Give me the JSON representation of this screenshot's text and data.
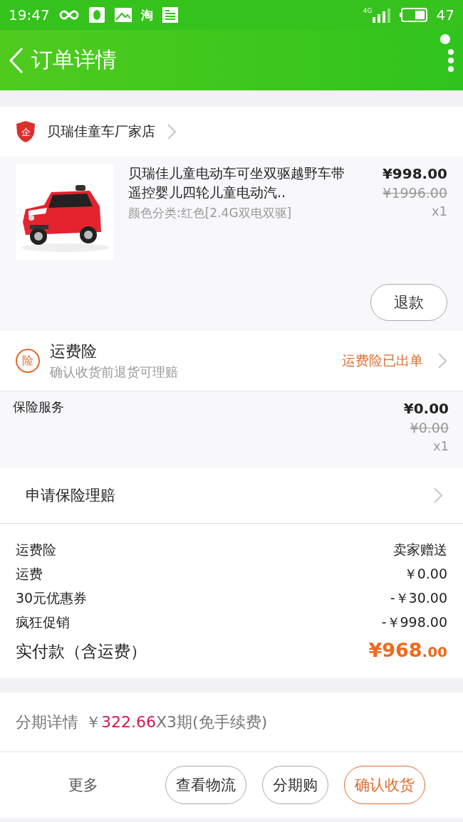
{
  "status_bar": {
    "time": "19:47",
    "app_glyph": "淘",
    "network": "4G",
    "battery": "47"
  },
  "header": {
    "title": "订单详情"
  },
  "shop": {
    "name": "贝瑞佳童车厂家店",
    "badge": "企"
  },
  "product": {
    "kind": "picture",
    "title": "贝瑞佳儿童电动车可坐双驱越野车带遥控婴儿四轮儿童电动汽..",
    "spec": "颜色分类:红色[2.4G双电双驱]",
    "price": "¥998.00",
    "original_price": "¥1996.00",
    "quantity": "x1",
    "action": "退款"
  },
  "freight_insurance": {
    "badge": "险",
    "title": "运费险",
    "subtitle": "确认收货前退货可理赔",
    "status": "运费险已出单"
  },
  "insurance_service": {
    "label": "保险服务",
    "price": "¥0.00",
    "original_price": "¥0.00",
    "quantity": "x1"
  },
  "claim": {
    "label": "申请保险理赔"
  },
  "summary": {
    "rows": [
      {
        "label": "运费险",
        "value": "卖家赠送"
      },
      {
        "label": "运费",
        "value": "￥0.00"
      },
      {
        "label": "30元优惠券",
        "value": "-￥30.00"
      },
      {
        "label": "疯狂促销",
        "value": "-￥998.00"
      }
    ],
    "total_label": "实付款（含运费）",
    "total_integer": "¥968",
    "total_decimal": ".00"
  },
  "installment": {
    "label": "分期详情",
    "currency": "￥",
    "amount": "322.66",
    "terms": "X3期(免手续费)"
  },
  "bottom_bar": {
    "more": "更多",
    "buttons": [
      {
        "label": "查看物流",
        "kind": "plain"
      },
      {
        "label": "分期购",
        "kind": "plain"
      },
      {
        "label": "确认收货",
        "kind": "primary"
      }
    ]
  }
}
